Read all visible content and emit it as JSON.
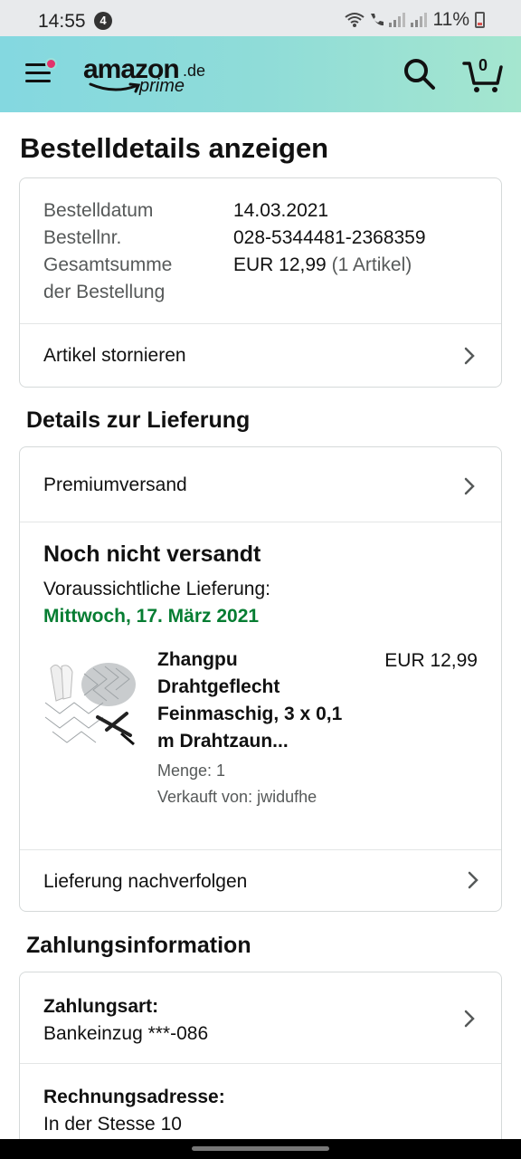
{
  "status_bar": {
    "time": "14:55",
    "badge": "4",
    "battery": "11%"
  },
  "header": {
    "logo_main": "amazon",
    "logo_domain": ".de",
    "logo_prime": "prime",
    "cart_count": "0"
  },
  "page": {
    "title": "Bestelldetails anzeigen"
  },
  "order": {
    "date_label": "Bestelldatum",
    "date_value": "14.03.2021",
    "number_label": "Bestellnr.",
    "number_value": "028-5344481-2368359",
    "total_label_1": "Gesamtsumme",
    "total_label_2": "der Bestellung",
    "total_value": "EUR 12,99",
    "total_items": "(1 Artikel)",
    "cancel_label": "Artikel stornieren"
  },
  "delivery": {
    "section_title": "Details zur Lieferung",
    "shipping_method": "Premiumversand",
    "status": "Noch nicht versandt",
    "expected_label": "Voraussichtliche Lieferung:",
    "expected_date": "Mittwoch, 17. März 2021",
    "product": {
      "title_lines": [
        "Zhangpu",
        "Drahtgeflecht",
        "Feinmaschig, 3 x 0,1",
        "m Drahtzaun..."
      ],
      "price": "EUR 12,99",
      "quantity": "Menge: 1",
      "seller": "Verkauft von: jwidufhe"
    },
    "track_label": "Lieferung nachverfolgen"
  },
  "payment": {
    "section_title": "Zahlungsinformation",
    "method_label": "Zahlungsart:",
    "method_value": "Bankeinzug ***-086",
    "address_label": "Rechnungsadresse:",
    "address_value": "In der Stesse 10"
  }
}
